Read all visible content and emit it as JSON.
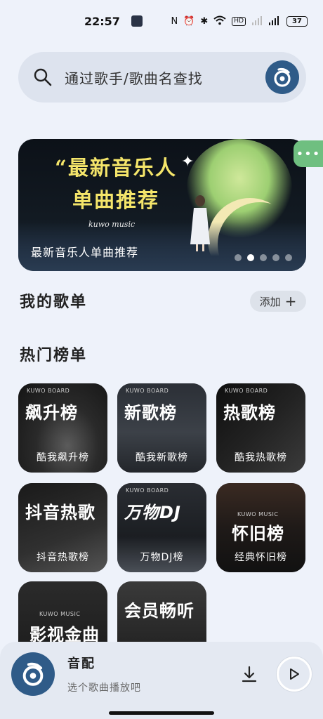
{
  "status_bar": {
    "time": "22:57",
    "battery": "37",
    "icons": [
      "nfc-icon",
      "alarm-icon",
      "bluetooth-icon",
      "wifi-icon",
      "hd-icon",
      "signal-icon",
      "4g-signal-icon",
      "battery-icon"
    ]
  },
  "search": {
    "placeholder": "通过歌手/歌曲名查找",
    "icon": "search-icon",
    "logo": "kuwo-logo-icon"
  },
  "banner": {
    "headline_line1": "“最新音乐人",
    "headline_line2": "单曲推荐",
    "brand": "kuwo music",
    "caption": "最新音乐人单曲推荐",
    "dots": 5,
    "active_dot": 2
  },
  "floating_chat": {
    "label": "•••",
    "color": "#6fbf80"
  },
  "my_playlists": {
    "title": "我的歌单",
    "add_label": "添加"
  },
  "hot_charts": {
    "title": "热门榜单",
    "cards": [
      {
        "brand": "KUWO BOARD",
        "title": "飙升榜",
        "caption": "酷我飙升榜"
      },
      {
        "brand": "KUWO BOARD",
        "title": "新歌榜",
        "caption": "酷我新歌榜"
      },
      {
        "brand": "KUWO BOARD",
        "title": "热歌榜",
        "caption": "酷我热歌榜"
      },
      {
        "brand": "",
        "title": "抖音热歌",
        "caption": "抖音热歌榜"
      },
      {
        "brand": "KUWO BOARD",
        "title": "万物DJ",
        "caption": "万物DJ榜"
      },
      {
        "brand": "KUWO MUSIC",
        "title": "怀旧榜",
        "caption": "经典怀旧榜"
      },
      {
        "brand": "KUWO MUSIC",
        "title": "影视金曲",
        "caption": ""
      },
      {
        "brand": "",
        "title": "会员畅听",
        "caption": ""
      }
    ]
  },
  "player": {
    "track_name": "音配",
    "hint": "选个歌曲播放吧",
    "download_icon": "download-icon",
    "play_icon": "play-icon"
  },
  "colors": {
    "background": "#eef2fa",
    "brand_blue": "#2f5b88",
    "banner_text": "#f4e56a"
  }
}
